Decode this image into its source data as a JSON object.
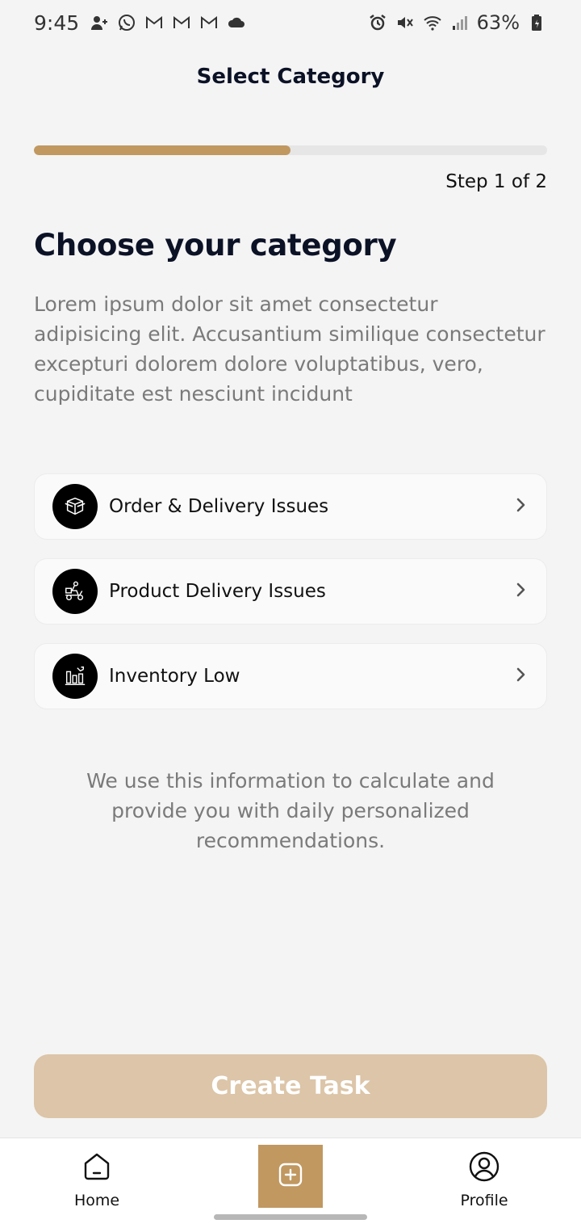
{
  "status_bar": {
    "time": "9:45",
    "battery": "63%",
    "left_icons": [
      "person-add-icon",
      "whatsapp-icon",
      "gmail-icon",
      "gmail-icon",
      "gmail-icon",
      "cloud-icon"
    ],
    "right_icons": [
      "alarm-icon",
      "mute-icon",
      "wifi-icon",
      "signal-icon",
      "battery-icon"
    ]
  },
  "header": {
    "title": "Select Category"
  },
  "progress": {
    "fraction": 0.5,
    "step_text": "Step 1 of 2",
    "color": "#c09860"
  },
  "main": {
    "heading": "Choose your category",
    "description": "Lorem ipsum dolor sit amet consectetur adipisicing elit. Accusantium similique consectetur excepturi dolorem dolore voluptatibus, vero, cupiditate est nesciunt incidunt",
    "categories": [
      {
        "label": "Order & Delivery Issues",
        "icon": "box-icon"
      },
      {
        "label": "Product Delivery Issues",
        "icon": "delivery-scooter-icon"
      },
      {
        "label": "Inventory Low",
        "icon": "bar-chart-trend-icon"
      }
    ],
    "info": "We use this information to calculate and provide you with daily personalized recommendations."
  },
  "cta": {
    "label": "Create Task"
  },
  "bottom_nav": {
    "home_label": "Home",
    "profile_label": "Profile",
    "add_icon": "plus-square-icon"
  },
  "colors": {
    "accent": "#c09860",
    "cta_disabled": "#dcc5a8",
    "heading": "#0c1226"
  }
}
